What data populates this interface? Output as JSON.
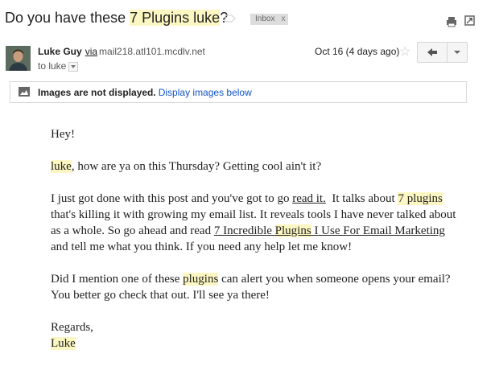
{
  "subject": {
    "prefix": "Do you have these ",
    "highlight": "7 Plugins luke",
    "suffix": "?",
    "label": "Inbox",
    "label_close": "x",
    "icons": [
      "important-marker-icon",
      "print-icon",
      "popout-icon"
    ]
  },
  "sender": {
    "name": "Luke Guy",
    "via": "via",
    "domain": "mail218.atl101.mcdlv.net",
    "to": "to luke",
    "date": "Oct 16 (4 days ago)",
    "icons": [
      "avatar",
      "star-icon",
      "reply-icon",
      "more-options-chevron-icon"
    ]
  },
  "images_banner": {
    "bold_text": "Images are not displayed.",
    "link_text": "Display images below",
    "icon": "image-icon"
  },
  "body": {
    "greeting": "Hey!",
    "p1_name": "luke",
    "p1_rest": ", how are ya on this Thursday? Getting cool ain't it?",
    "p2_a": "I just got done with this post and you've got to go ",
    "p2_link1": "read it.",
    "p2_b": "  It talks about ",
    "p2_hl": "7 plugins",
    "p2_c": "that's killing it with growing my email list. It reveals tools I have never talked about as a whole. So go ahead and read ",
    "p2_link2_a": "7 Incredible ",
    "p2_link2_hl": "Plugins",
    "p2_link2_b": " I Use For Email Marketing",
    "p2_d": " and tell me what you think. If you need any help let me know!",
    "p3_a": "Did I mention one of these ",
    "p3_hl": "plugins",
    "p3_b": " can alert you when someone opens your email? You better go check that out. I'll see ya there!",
    "signoff": "Regards,",
    "signature": "Luke"
  },
  "colors": {
    "highlight": "#fcf7c2",
    "link": "#1155cc",
    "label_bg": "#dddddd"
  }
}
